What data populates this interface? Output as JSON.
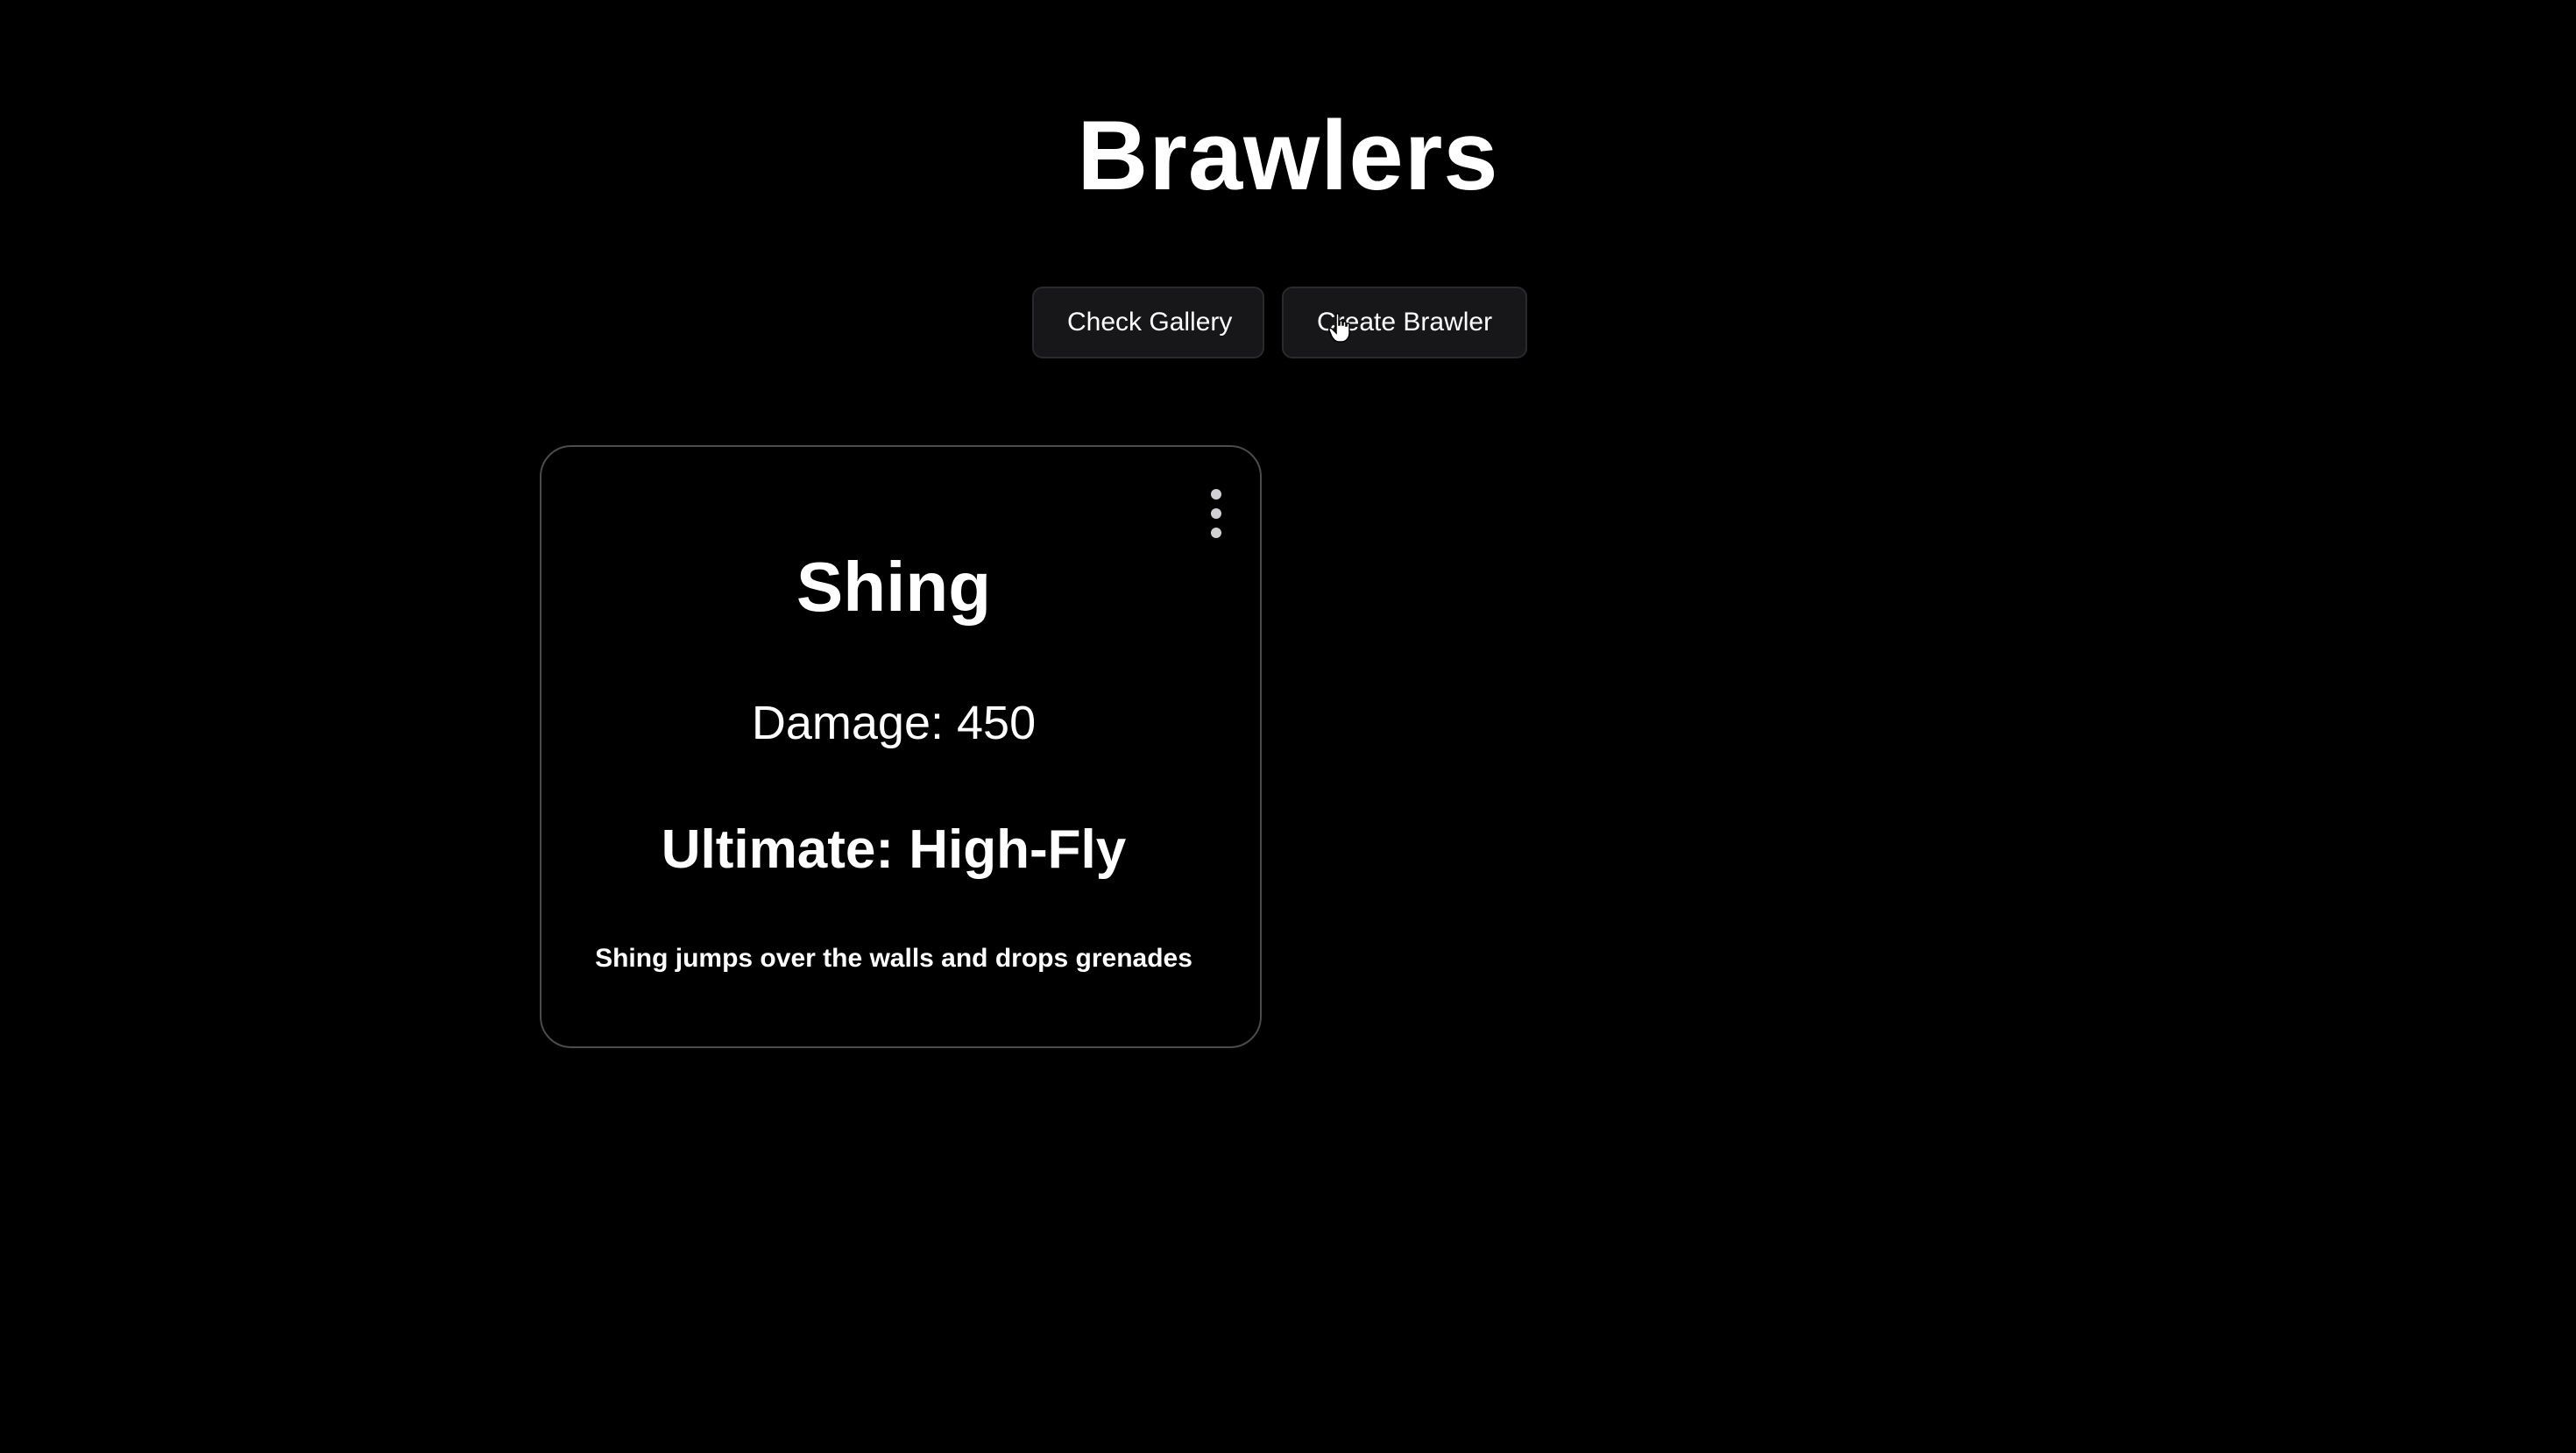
{
  "page": {
    "title": "Brawlers"
  },
  "toolbar": {
    "gallery_label": "Check Gallery",
    "create_label": "Create Brawler"
  },
  "cards": [
    {
      "name": "Shing",
      "damage": "Damage: 450",
      "ultimate": "Ultimate: High-Fly",
      "description": "Shing jumps over the walls and drops grenades",
      "menu_icon": "more-vertical-icon"
    }
  ],
  "colors": {
    "background": "#000000",
    "text": "#ffffff",
    "button_bg": "#17171a",
    "card_border": "#4a4a4f"
  },
  "icons": {
    "cursor": "hand-pointer-icon"
  }
}
